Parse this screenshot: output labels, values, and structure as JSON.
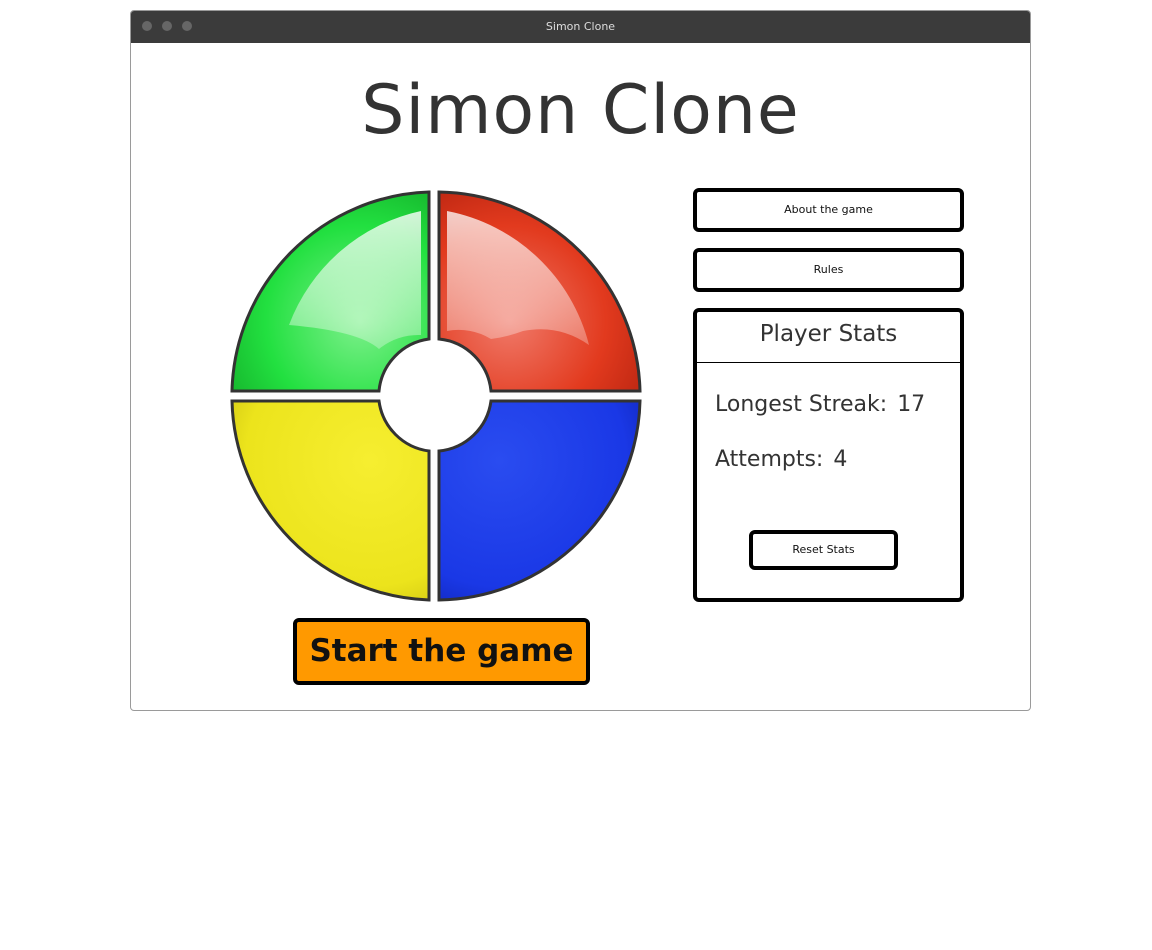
{
  "window": {
    "title": "Simon Clone"
  },
  "page": {
    "title": "Simon Clone"
  },
  "game": {
    "quadrants": [
      {
        "color_name": "green",
        "color": "#1ee03c"
      },
      {
        "color_name": "red",
        "color": "#e0301a"
      },
      {
        "color_name": "yellow",
        "color": "#f0ea20"
      },
      {
        "color_name": "blue",
        "color": "#1a3be8"
      }
    ],
    "start_label": "Start the game"
  },
  "sidebar": {
    "about_label": "About the game",
    "rules_label": "Rules"
  },
  "stats": {
    "header": "Player Stats",
    "longest_streak_label": "Longest Streak:",
    "longest_streak_value": "17",
    "attempts_label": "Attempts:",
    "attempts_value": "4",
    "reset_label": "Reset Stats"
  },
  "colors": {
    "start_button": "#ff9900",
    "border": "#000000",
    "titlebar": "#3b3b3b"
  }
}
